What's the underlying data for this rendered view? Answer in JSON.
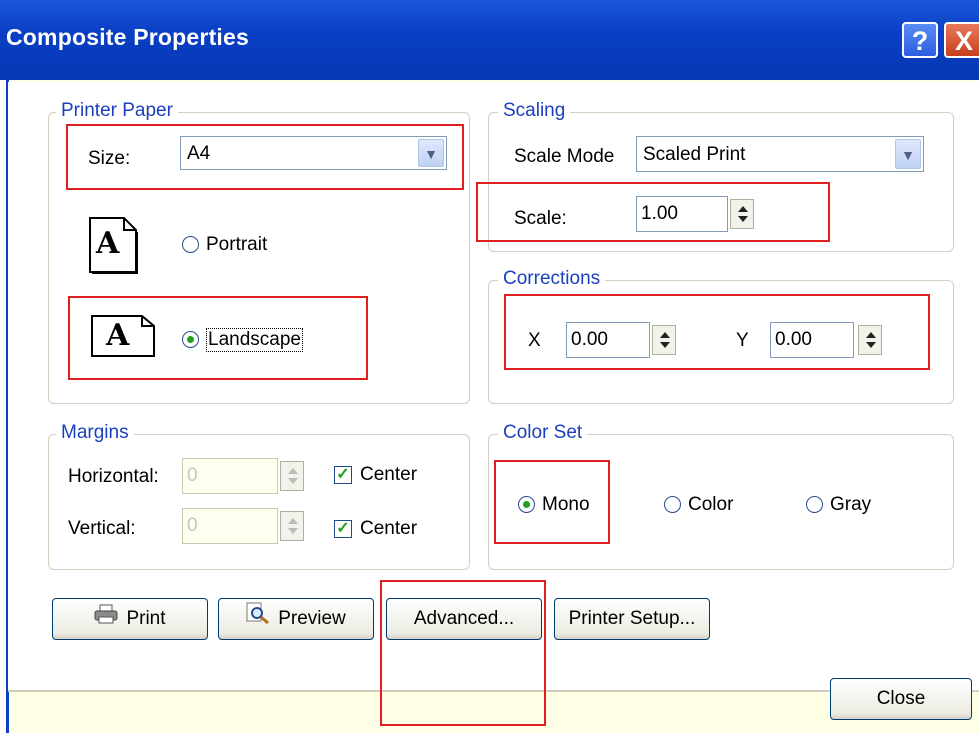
{
  "window": {
    "title": "Composite Properties",
    "help_glyph": "?",
    "close_glyph": "X"
  },
  "printer_paper": {
    "legend": "Printer Paper",
    "size_label": "Size:",
    "size_value": "A4",
    "portrait_label": "Portrait",
    "landscape_label": "Landscape",
    "selected_orientation": "landscape",
    "page_icon_glyph": "A"
  },
  "scaling": {
    "legend": "Scaling",
    "mode_label": "Scale Mode",
    "mode_value": "Scaled Print",
    "scale_label": "Scale:",
    "scale_value": "1.00"
  },
  "corrections": {
    "legend": "Corrections",
    "x_label": "X",
    "x_value": "0.00",
    "y_label": "Y",
    "y_value": "0.00"
  },
  "margins": {
    "legend": "Margins",
    "horizontal_label": "Horizontal:",
    "horizontal_value": "0",
    "horizontal_center_label": "Center",
    "vertical_label": "Vertical:",
    "vertical_value": "0",
    "vertical_center_label": "Center"
  },
  "color_set": {
    "legend": "Color Set",
    "options": [
      "Mono",
      "Color",
      "Gray"
    ],
    "selected": "Mono"
  },
  "buttons": {
    "print": "Print",
    "preview": "Preview",
    "advanced": "Advanced...",
    "printer_setup": "Printer Setup...",
    "close": "Close"
  },
  "colors": {
    "titlebar": "#0a3fc4",
    "highlight_box": "#e02020",
    "group_legend": "#1b3fbf",
    "radio_dot": "#20a020"
  }
}
